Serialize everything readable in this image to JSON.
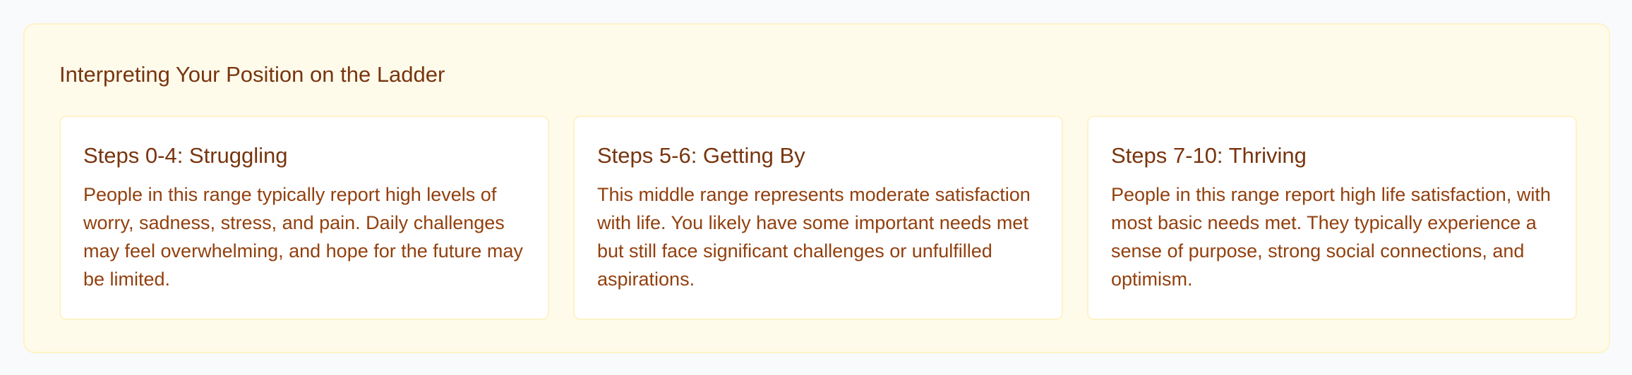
{
  "section": {
    "title": "Interpreting Your Position on the Ladder",
    "cards": [
      {
        "title": "Steps 0-4: Struggling",
        "body": "People in this range typically report high levels of worry, sadness, stress, and pain. Daily challenges may feel overwhelming, and hope for the future may be limited."
      },
      {
        "title": "Steps 5-6: Getting By",
        "body": "This middle range represents moderate satisfaction with life. You likely have some important needs met but still face significant challenges or unfulfilled aspirations."
      },
      {
        "title": "Steps 7-10: Thriving",
        "body": "People in this range report high life satisfaction, with most basic needs met. They typically experience a sense of purpose, strong social connections, and optimism."
      }
    ]
  },
  "colors": {
    "page_background": "#f8fafc",
    "panel_background": "#fffbeb",
    "panel_border": "#fef3c7",
    "card_background": "#ffffff",
    "heading_text": "#78350f",
    "body_text": "#92400e"
  }
}
